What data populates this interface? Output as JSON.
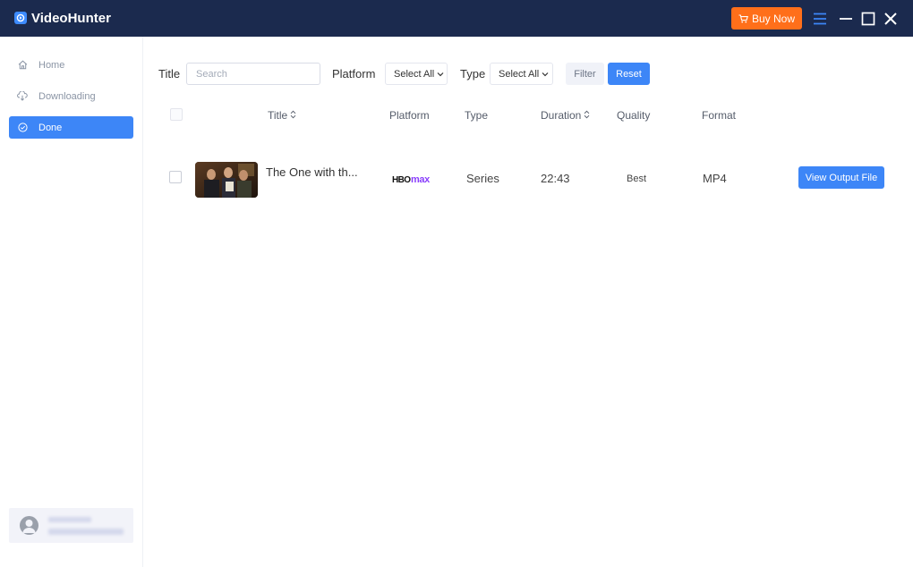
{
  "app": {
    "title": "VideoHunter"
  },
  "titlebar": {
    "buy_label": "Buy Now",
    "accent": "#ff6f1a",
    "background": "#1b2a4e"
  },
  "sidebar": {
    "items": [
      {
        "label": "Home",
        "icon": "home-icon",
        "active": false
      },
      {
        "label": "Downloading",
        "icon": "download-cloud-icon",
        "active": false
      },
      {
        "label": "Done",
        "icon": "check-circle-icon",
        "active": true
      }
    ],
    "active_color": "#3d86f7"
  },
  "filters": {
    "title_label": "Title",
    "search_placeholder": "Search",
    "platform_label": "Platform",
    "platform_value": "Select All",
    "type_label": "Type",
    "type_value": "Select All",
    "filter_button": "Filter",
    "reset_button": "Reset"
  },
  "table": {
    "columns": [
      "Title",
      "Platform",
      "Type",
      "Duration",
      "Quality",
      "Format"
    ],
    "rows": [
      {
        "title": "The One with th...",
        "platform": "HBO max",
        "type": "Series",
        "duration": "22:43",
        "quality": "Best",
        "format": "MP4",
        "action": "View Output File"
      }
    ]
  }
}
